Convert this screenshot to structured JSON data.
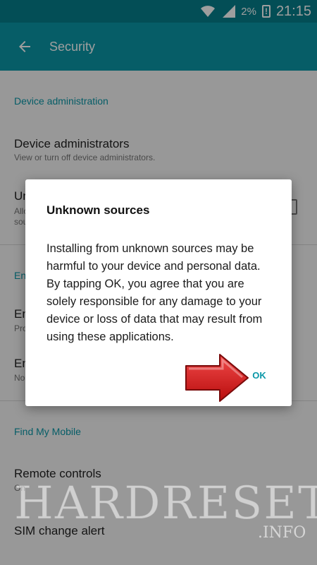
{
  "status_bar": {
    "battery_percent": "2%",
    "time": "21:15",
    "icons": [
      "wifi-icon",
      "signal-icon",
      "battery-alert-icon"
    ]
  },
  "toolbar": {
    "title": "Security",
    "back_icon": "arrow-left-icon"
  },
  "settings": {
    "device_admin_header": "Device administration",
    "device_admins_title": "Device administrators",
    "device_admins_sub": "View or turn off device administrators.",
    "unknown_title": "Un",
    "unknown_sub1": "Allo",
    "unknown_sub2": "sou",
    "encryption_header": "En",
    "encrypt_device_title": "En",
    "encrypt_device_sub": "Pro",
    "encrypt_sd_title": "En",
    "encrypt_sd_sub": "No",
    "find_my_mobile_header": "Find My Mobile",
    "remote_controls_title": "Remote controls",
    "remote_controls_sub": "On",
    "sim_change_title": "SIM change alert"
  },
  "dialog": {
    "title": "Unknown sources",
    "body": "Installing from unknown sources may be harmful to your device and personal data. By tapping OK, you agree that you are solely responsible for any damage to your device or loss of data that may result from using these applications.",
    "ok_label": "OK"
  },
  "watermark": {
    "text": "HARDRESET",
    "sub": ".INFO"
  },
  "colors": {
    "status_bar": "#057f8c",
    "toolbar": "#0a97a7",
    "accent": "#0a97a7",
    "arrow": "#d61d1d"
  }
}
